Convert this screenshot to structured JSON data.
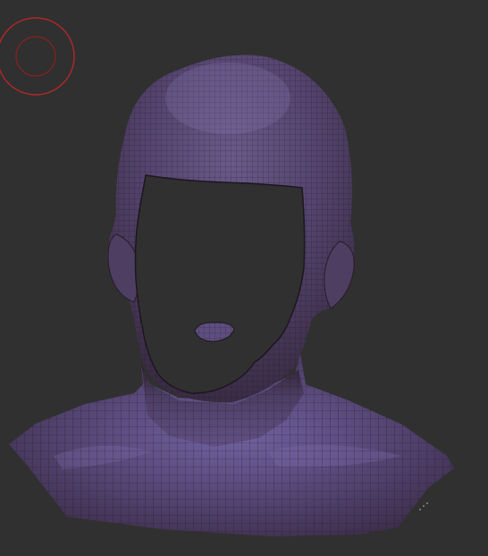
{
  "viewport": {
    "background_color": "#303030",
    "tool": "brush-cursor-icon",
    "brush_color": "#b42828",
    "model": {
      "object": "head-bust-mesh",
      "material_base_color": "#5a4a78",
      "material_shadow_color": "#3a2a3a",
      "material_rim_color": "#7a5a6a",
      "wireframe_color": "#1a1420",
      "wireframe_visible": true,
      "hole_color": "#303030"
    }
  }
}
